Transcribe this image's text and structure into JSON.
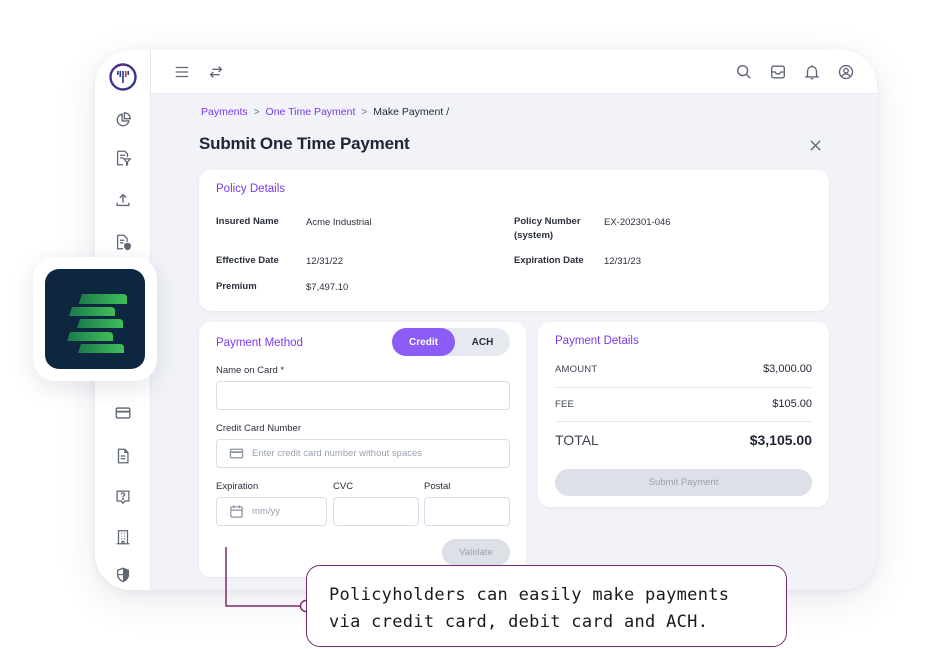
{
  "app": {
    "brand_color": "#7c3aed",
    "logo_icon": "brand-logo-icon"
  },
  "sidebar": {
    "items": [
      {
        "icon": "pie-chart-icon",
        "label": "Dashboard"
      },
      {
        "icon": "document-filter-icon",
        "label": "Policies"
      },
      {
        "icon": "upload-icon",
        "label": "Upload"
      },
      {
        "icon": "document-shield-icon",
        "label": "Claims"
      },
      {
        "icon": "credit-card-icon",
        "label": "Payments"
      },
      {
        "icon": "document-icon",
        "label": "Documents"
      },
      {
        "icon": "help-icon",
        "label": "Help"
      },
      {
        "icon": "building-icon",
        "label": "Company"
      },
      {
        "icon": "shield-icon",
        "label": "Security"
      }
    ]
  },
  "topbar": {
    "left_icons": [
      "menu-icon",
      "switch-icon"
    ],
    "right_icons": [
      "search-icon",
      "inbox-icon",
      "bell-icon",
      "user-icon"
    ]
  },
  "breadcrumb": {
    "items": [
      "Payments",
      "One Time Payment"
    ],
    "current": "Make Payment /"
  },
  "page": {
    "title": "Submit One Time Payment"
  },
  "policy_details": {
    "title": "Policy Details",
    "insured_name_label": "Insured Name",
    "insured_name": "Acme Industrial",
    "policy_number_label_1": "Policy Number",
    "policy_number_label_2": "(system)",
    "policy_number": "EX-202301-046",
    "effective_date_label": "Effective Date",
    "effective_date": "12/31/22",
    "expiration_date_label": "Expiration Date",
    "expiration_date": "12/31/23",
    "premium_label": "Premium",
    "premium": "$7,497.10"
  },
  "payment_method": {
    "title": "Payment Method",
    "toggle": {
      "options": [
        "Credit",
        "ACH"
      ],
      "selected": "Credit"
    },
    "name_on_card_label": "Name on Card *",
    "name_on_card_value": "",
    "card_number_label": "Credit Card Number",
    "card_number_placeholder": "Enter credit card number without spaces",
    "expiration_label": "Expiration",
    "expiration_placeholder": "mm/yy",
    "cvc_label": "CVC",
    "postal_label": "Postal",
    "validate_label": "Validate"
  },
  "payment_details": {
    "title": "Payment Details",
    "amount_label": "AMOUNT",
    "amount": "$3,000.00",
    "fee_label": "FEE",
    "fee": "$105.00",
    "total_label": "TOTAL",
    "total": "$3,105.00",
    "submit_label": "Submit Payment"
  },
  "callout": {
    "line1": "Policyholders can easily make payments",
    "line2": "via credit card, debit card and ACH."
  }
}
